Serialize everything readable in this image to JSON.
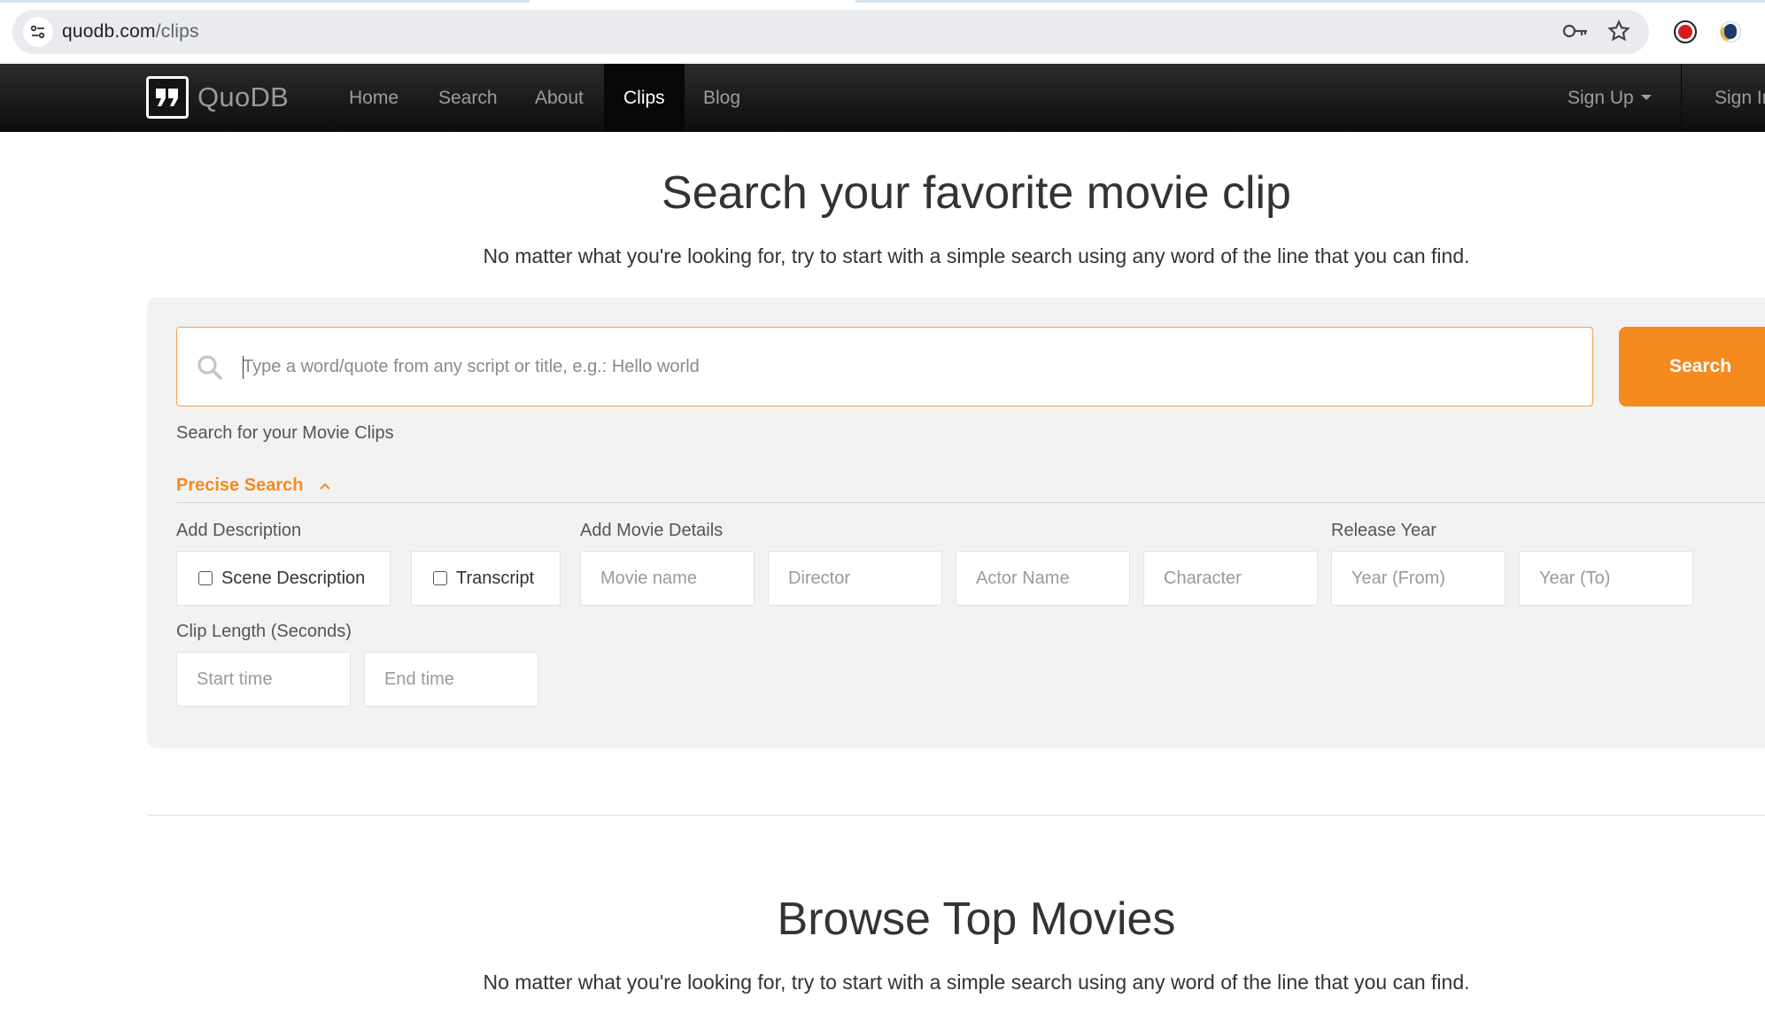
{
  "browser": {
    "url_domain": "quodb.com",
    "url_path": "/clips"
  },
  "navbar": {
    "brand": "QuoDB",
    "links": [
      {
        "label": "Home"
      },
      {
        "label": "Search"
      },
      {
        "label": "About"
      },
      {
        "label": "Clips",
        "active": true
      },
      {
        "label": "Blog"
      }
    ],
    "signup": "Sign Up",
    "signin": "Sign In"
  },
  "hero": {
    "title": "Search your favorite movie clip",
    "subtitle": "No matter what you're looking for, try to start with a simple search using any word of the line that you can find."
  },
  "search": {
    "placeholder": "Type a word/quote from any script or title, e.g.: Hello world",
    "button": "Search",
    "hint": "Search for your Movie Clips",
    "precise_toggle": "Precise Search"
  },
  "filters": {
    "description_label": "Add Description",
    "scene_description": "Scene Description",
    "transcript": "Transcript",
    "movie_details_label": "Add Movie Details",
    "movie_name": "Movie name",
    "director": "Director",
    "actor_name": "Actor Name",
    "character": "Character",
    "release_year_label": "Release Year",
    "year_from": "Year (From)",
    "year_to": "Year (To)",
    "clip_length_label": "Clip Length (Seconds)",
    "start_time": "Start time",
    "end_time": "End time"
  },
  "browse": {
    "title": "Browse Top Movies",
    "subtitle": "No matter what you're looking for, try to start with a simple search using any word of the line that you can find."
  },
  "colors": {
    "accent": "#f58a1f",
    "navbar": "#1a1a1a",
    "panel": "#f2f2f2"
  }
}
